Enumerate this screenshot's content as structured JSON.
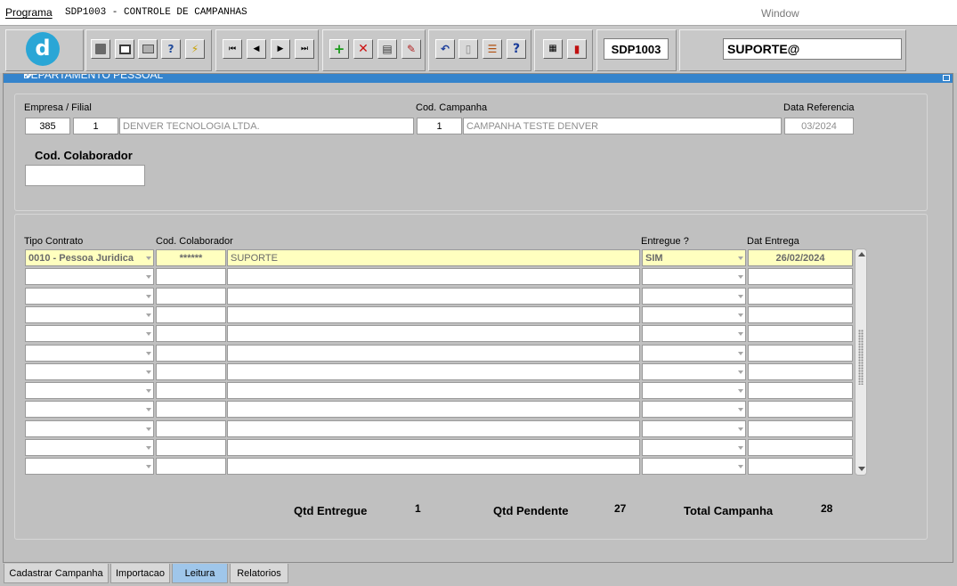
{
  "menubar": {
    "program_label": "Programa",
    "title": "SDP1003 - CONTROLE DE CAMPANHAS",
    "window_label": "Window"
  },
  "toolbar": {
    "logo_letter": "d",
    "program_code": "SDP1003",
    "user": "SUPORTE@"
  },
  "panel": {
    "header_title": "DEPARTAMENTO PESSOAL"
  },
  "header": {
    "empresa_filial_label": "Empresa / Filial",
    "empresa": "385",
    "filial": "1",
    "empresa_nome": "DENVER TECNOLOGIA LTDA.",
    "cod_campanha_label": "Cod. Campanha",
    "cod_campanha": "1",
    "campanha_nome": "CAMPANHA TESTE DENVER",
    "data_referencia_label": "Data Referencia",
    "data_referencia": "03/2024",
    "cod_colaborador_label": "Cod. Colaborador",
    "cod_colaborador": ""
  },
  "grid": {
    "columns": {
      "tipo_contrato": "Tipo Contrato",
      "cod_colaborador": "Cod. Colaborador",
      "entregue": "Entregue ?",
      "dat_entrega": "Dat Entrega"
    },
    "rows": [
      {
        "tipo_contrato": "0010 - Pessoa Juridica",
        "cod_colaborador": "******",
        "nome": "SUPORTE",
        "entregue": "SIM",
        "dat_entrega": "26/02/2024"
      },
      {
        "tipo_contrato": "",
        "cod_colaborador": "",
        "nome": "",
        "entregue": "",
        "dat_entrega": ""
      },
      {
        "tipo_contrato": "",
        "cod_colaborador": "",
        "nome": "",
        "entregue": "",
        "dat_entrega": ""
      },
      {
        "tipo_contrato": "",
        "cod_colaborador": "",
        "nome": "",
        "entregue": "",
        "dat_entrega": ""
      },
      {
        "tipo_contrato": "",
        "cod_colaborador": "",
        "nome": "",
        "entregue": "",
        "dat_entrega": ""
      },
      {
        "tipo_contrato": "",
        "cod_colaborador": "",
        "nome": "",
        "entregue": "",
        "dat_entrega": ""
      },
      {
        "tipo_contrato": "",
        "cod_colaborador": "",
        "nome": "",
        "entregue": "",
        "dat_entrega": ""
      },
      {
        "tipo_contrato": "",
        "cod_colaborador": "",
        "nome": "",
        "entregue": "",
        "dat_entrega": ""
      },
      {
        "tipo_contrato": "",
        "cod_colaborador": "",
        "nome": "",
        "entregue": "",
        "dat_entrega": ""
      },
      {
        "tipo_contrato": "",
        "cod_colaborador": "",
        "nome": "",
        "entregue": "",
        "dat_entrega": ""
      },
      {
        "tipo_contrato": "",
        "cod_colaborador": "",
        "nome": "",
        "entregue": "",
        "dat_entrega": ""
      },
      {
        "tipo_contrato": "",
        "cod_colaborador": "",
        "nome": "",
        "entregue": "",
        "dat_entrega": ""
      }
    ]
  },
  "totals": {
    "qtd_entregue_label": "Qtd Entregue",
    "qtd_entregue": "1",
    "qtd_pendente_label": "Qtd Pendente",
    "qtd_pendente": "27",
    "total_campanha_label": "Total Campanha",
    "total_campanha": "28"
  },
  "tabs": [
    {
      "label": "Cadastrar Campanha",
      "active": false
    },
    {
      "label": "Importacao",
      "active": false
    },
    {
      "label": "Leitura",
      "active": true
    },
    {
      "label": "Relatorios",
      "active": false
    }
  ],
  "icons": [
    "save-icon",
    "window-icon",
    "print-icon",
    "query-icon",
    "execute-query-icon",
    "first-record-icon",
    "previous-record-icon",
    "next-record-icon",
    "last-record-icon",
    "insert-record-icon",
    "delete-record-icon",
    "clear-record-icon",
    "edit-icon",
    "undo-icon",
    "clipboard-icon",
    "list-values-icon",
    "help-icon",
    "menu-icon",
    "exit-icon"
  ],
  "colors": {
    "panel_header": "#3584cc",
    "highlight_row": "#ffffbf",
    "active_tab": "#9fc6ea",
    "logo": "#2aa6d6"
  }
}
